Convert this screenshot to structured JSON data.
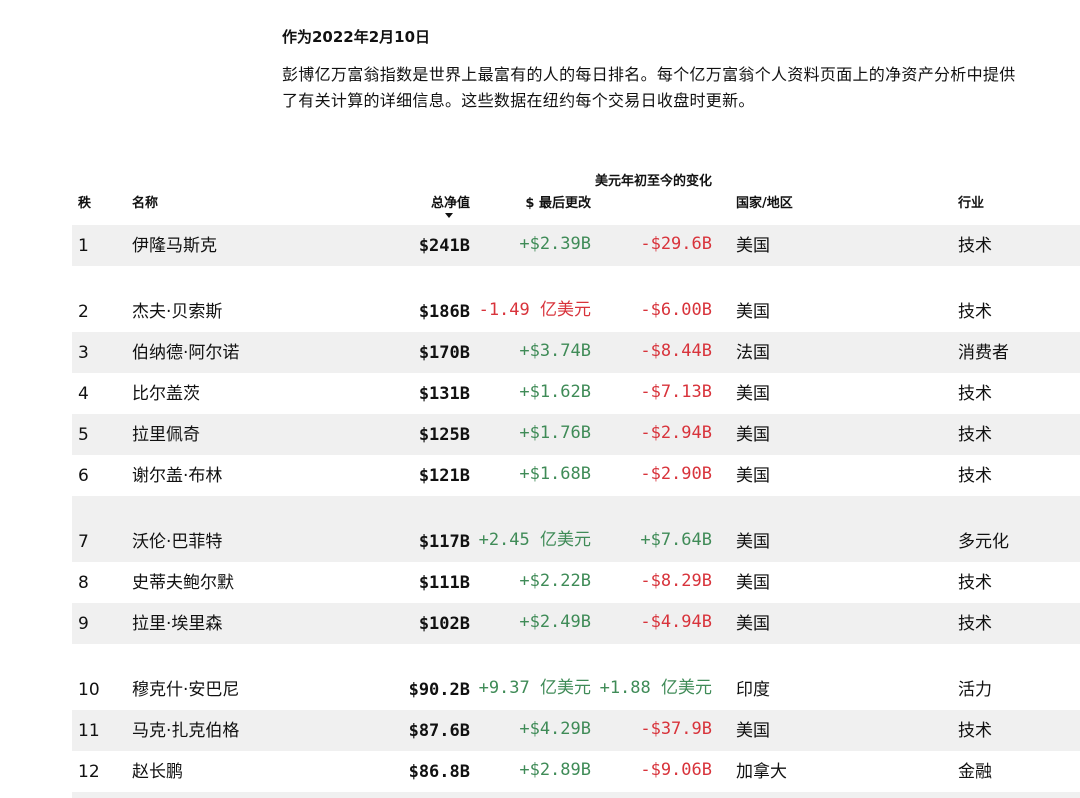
{
  "date_line": "作为2022年2月10日",
  "intro": "彭博亿万富翁指数是世界上最富有的人的每日排名。每个亿万富翁个人资料页面上的净资产分析中提供了有关计算的详细信息。这些数据在纽约每个交易日收盘时更新。",
  "table": {
    "headers": {
      "rank": "秩",
      "name": "名称",
      "net_worth": "总净值",
      "last_change": "$ 最后更改",
      "ytd_change": "美元年初至今的变化",
      "country": "国家/地区",
      "industry": "行业"
    },
    "rows": [
      {
        "rank": "1",
        "name": "伊隆马斯克",
        "net_worth": "$241B",
        "last_change": "+$2.39B",
        "ytd_change": "-$29.6B",
        "country": "美国",
        "industry": "技术"
      },
      {
        "rank": "2",
        "name": "杰夫·贝索斯",
        "net_worth": "$186B",
        "last_change": "-1.49 亿美元",
        "ytd_change": "-$6.00B",
        "country": "美国",
        "industry": "技术"
      },
      {
        "rank": "3",
        "name": "伯纳德·阿尔诺",
        "net_worth": "$170B",
        "last_change": "+$3.74B",
        "ytd_change": "-$8.44B",
        "country": "法国",
        "industry": "消费者"
      },
      {
        "rank": "4",
        "name": "比尔盖茨",
        "net_worth": "$131B",
        "last_change": "+$1.62B",
        "ytd_change": "-$7.13B",
        "country": "美国",
        "industry": "技术"
      },
      {
        "rank": "5",
        "name": "拉里佩奇",
        "net_worth": "$125B",
        "last_change": "+$1.76B",
        "ytd_change": "-$2.94B",
        "country": "美国",
        "industry": "技术"
      },
      {
        "rank": "6",
        "name": "谢尔盖·布林",
        "net_worth": "$121B",
        "last_change": "+$1.68B",
        "ytd_change": "-$2.90B",
        "country": "美国",
        "industry": "技术"
      },
      {
        "rank": "7",
        "name": "沃伦·巴菲特",
        "net_worth": "$117B",
        "last_change": "+2.45 亿美元",
        "ytd_change": "+$7.64B",
        "country": "美国",
        "industry": "多元化"
      },
      {
        "rank": "8",
        "name": "史蒂夫鲍尔默",
        "net_worth": "$111B",
        "last_change": "+$2.22B",
        "ytd_change": "-$8.29B",
        "country": "美国",
        "industry": "技术"
      },
      {
        "rank": "9",
        "name": "拉里·埃里森",
        "net_worth": "$102B",
        "last_change": "+$2.49B",
        "ytd_change": "-$4.94B",
        "country": "美国",
        "industry": "技术"
      },
      {
        "rank": "10",
        "name": "穆克什·安巴尼",
        "net_worth": "$90.2B",
        "last_change": "+9.37 亿美元",
        "ytd_change": "+1.88 亿美元",
        "country": "印度",
        "industry": "活力"
      },
      {
        "rank": "11",
        "name": "马克·扎克伯格",
        "net_worth": "$87.6B",
        "last_change": "+$4.29B",
        "ytd_change": "-$37.9B",
        "country": "美国",
        "industry": "技术"
      },
      {
        "rank": "12",
        "name": "赵长鹏",
        "net_worth": "$86.8B",
        "last_change": "+$2.89B",
        "ytd_change": "-$9.06B",
        "country": "加拿大",
        "industry": "金融"
      }
    ]
  },
  "colors": {
    "positive": "#3f8b57",
    "negative": "#d8333b",
    "row_shade": "#f0f0f0"
  }
}
